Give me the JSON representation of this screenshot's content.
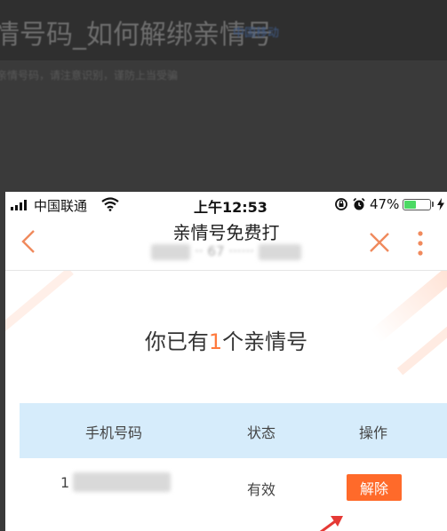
{
  "background": {
    "title": "情号码_如何解绑亲情号",
    "title_tag": "中国移动",
    "subtitle": "亲情号码，请注意识别，谨防上当受骗"
  },
  "statusbar": {
    "carrier": "中国联通",
    "time": "上午12:53",
    "battery": "47%",
    "battery_level": 0.47
  },
  "navbar": {
    "title": "亲情号免费打",
    "subtitle": "·· 67 ······"
  },
  "main": {
    "headline_prefix": "你已有",
    "headline_count": "1",
    "headline_suffix": "个亲情号"
  },
  "table": {
    "headers": [
      "手机号码",
      "状态",
      "操作"
    ],
    "rows": [
      {
        "phone_visible_prefix": "1",
        "status": "有效",
        "action": "解除"
      }
    ]
  },
  "colors": {
    "accent": "#ff6a2a",
    "table_header_bg": "#d6ecfb",
    "icon_orange": "#f08a5d",
    "arrow_red": "#e53935"
  }
}
